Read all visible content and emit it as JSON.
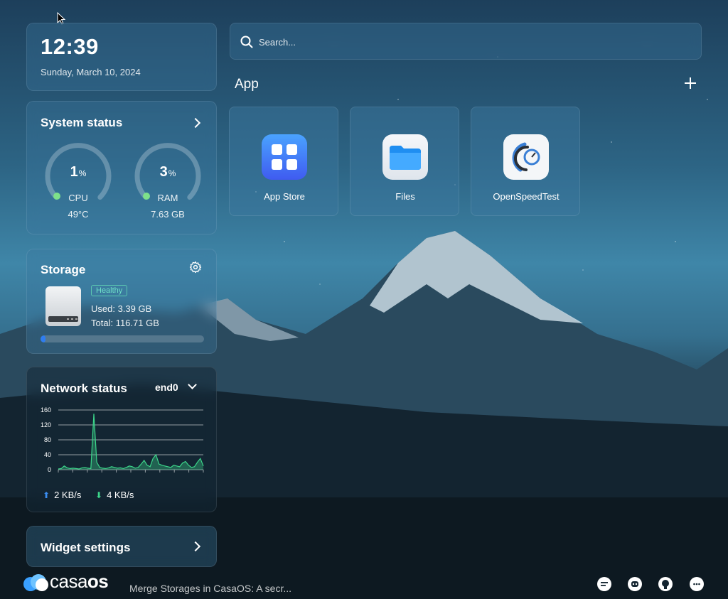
{
  "clock": {
    "time": "12:39",
    "date": "Sunday, March 10, 2024"
  },
  "system_status": {
    "title": "System status",
    "cpu": {
      "value": "1",
      "unit": "%",
      "label": "CPU",
      "sub": "49°C",
      "fraction": 0.01
    },
    "ram": {
      "value": "3",
      "unit": "%",
      "label": "RAM",
      "sub": "7.63 GB",
      "fraction": 0.03
    }
  },
  "storage": {
    "title": "Storage",
    "badge": "Healthy",
    "used": "Used: 3.39 GB",
    "total": "Total: 116.71 GB",
    "used_fraction": 0.03
  },
  "network": {
    "title": "Network status",
    "interface": "end0",
    "upload": "2 KB/s",
    "download": "4 KB/s",
    "y_ticks": [
      "160",
      "120",
      "80",
      "40",
      "0"
    ],
    "chart_data": {
      "type": "area",
      "ylim": [
        0,
        160
      ],
      "series": [
        {
          "values": [
            2,
            3,
            10,
            5,
            3,
            4,
            3,
            2,
            5,
            6,
            4,
            3,
            150,
            20,
            6,
            4,
            3,
            5,
            8,
            6,
            4,
            5,
            3,
            6,
            10,
            8,
            4,
            6,
            15,
            25,
            12,
            8,
            30,
            40,
            15,
            12,
            10,
            8,
            6,
            12,
            10,
            8,
            18,
            22,
            12,
            6,
            8,
            20,
            30,
            10
          ]
        }
      ]
    }
  },
  "widget_settings": {
    "title": "Widget settings"
  },
  "search": {
    "placeholder": "Search..."
  },
  "apps_section": {
    "title": "App"
  },
  "apps": [
    {
      "name": "App Store",
      "icon": "app-store-icon"
    },
    {
      "name": "Files",
      "icon": "folder-icon"
    },
    {
      "name": "OpenSpeedTest",
      "icon": "speedtest-icon"
    }
  ],
  "footer": {
    "brand_a": "casa",
    "brand_b": "os",
    "news": "Merge Storages in CasaOS: A secr..."
  },
  "colors": {
    "accent": "#2f7df0",
    "healthy": "#5cc7b1",
    "gauge_dot": "#7ee08a"
  }
}
